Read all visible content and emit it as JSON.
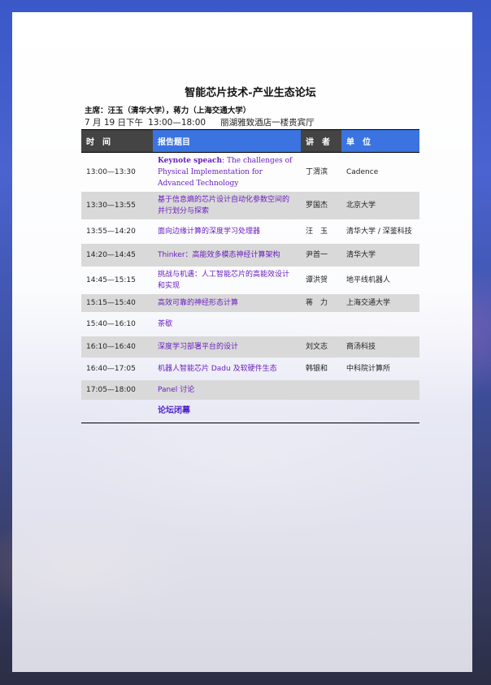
{
  "forum": {
    "title": "智能芯片技术-产业生态论坛",
    "chairs": "主席：汪玉（清华大学），蒋力（上海交通大学）",
    "date": "7 月 19 日下午",
    "time_range": "13:00—18:00",
    "venue": "丽湖雅致酒店一楼贵宾厅"
  },
  "table": {
    "headers": [
      "时　间",
      "报告题目",
      "讲　者",
      "单　位"
    ],
    "rows": [
      {
        "time": "13:00—13:30",
        "keynote": "Keynote speach",
        "topic": ": The challenges of Physical Implementation for Advanced Technology",
        "speaker": "丁渭滨",
        "org": "Cadence"
      },
      {
        "time": "13:30—13:55",
        "topic": "基于信息熵的芯片设计自动化参数空间的并行划分与探索",
        "speaker": "罗国杰",
        "org": "北京大学"
      },
      {
        "time": "13:55—14:20",
        "topic": "面向边缘计算的深度学习处理器",
        "speaker": "汪　玉",
        "org": "清华大学 / 深鉴科技"
      },
      {
        "time": "14:20—14:45",
        "topic": "Thinker：高能效多模态神经计算架构",
        "speaker": "尹首一",
        "org": "清华大学"
      },
      {
        "time": "14:45—15:15",
        "topic": "挑战与机遇：人工智能芯片的高能效设计和实现",
        "speaker": "谭洪贺",
        "org": "地平线机器人"
      },
      {
        "time": "15:15—15:40",
        "topic": "高效可靠的神经形态计算",
        "speaker": "蒋　力",
        "org": "上海交通大学"
      },
      {
        "time": "15:40—16:10",
        "topic": "茶歇",
        "speaker": "",
        "org": ""
      },
      {
        "time": "16:10—16:40",
        "topic": "深度学习部署平台的设计",
        "speaker": "刘文志",
        "org": "商汤科技"
      },
      {
        "time": "16:40—17:05",
        "topic": "机器人智能芯片 Dadu 及软硬件生态",
        "speaker": "韩银和",
        "org": "中科院计算所"
      },
      {
        "time": "17:05—18:00",
        "topic": "Panel 讨论",
        "speaker": "",
        "org": ""
      },
      {
        "time": "",
        "topic": "论坛闭幕",
        "speaker": "",
        "org": ""
      }
    ]
  },
  "colors": {
    "header_dark": "#444444",
    "header_blue": "#3b74e0",
    "topic_purple": "#6a1fbf",
    "row_shade": "#d9d9d9"
  }
}
